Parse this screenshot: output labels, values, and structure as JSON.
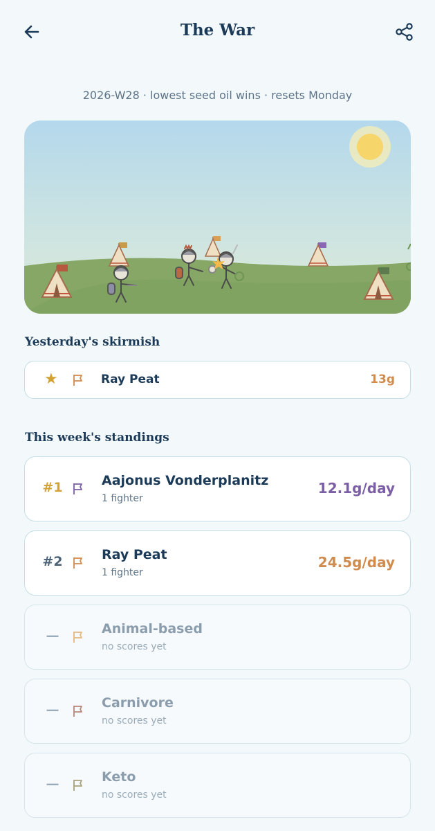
{
  "header": {
    "title": "The War",
    "back_icon": "back-arrow-icon",
    "share_icon": "share-icon"
  },
  "subtitle": "2026-W28 · lowest seed oil wins · resets Monday",
  "scene": {
    "sun_icon": "sun-icon",
    "colors": {
      "sky_top": "#b4d8ec",
      "sky_bottom": "#dfecd9",
      "grass": "#86a766",
      "grass_dark": "#6e9553"
    }
  },
  "yesterday": {
    "heading": "Yesterday's skirmish",
    "winner_icon": "star-icon",
    "name": "Ray Peat",
    "value": "13g",
    "flag_color": "#d08b4e"
  },
  "standings": {
    "heading": "This week's standings",
    "items": [
      {
        "rank": "#1",
        "name": "Aajonus Vonderplanitz",
        "sub": "1 fighter",
        "value": "12.1g/day",
        "rank_color": "#d3a235",
        "flag_color": "#7b5ea3",
        "value_color": "#7b5ea3",
        "empty": false
      },
      {
        "rank": "#2",
        "name": "Ray Peat",
        "sub": "1 fighter",
        "value": "24.5g/day",
        "rank_color": "#4d6478",
        "flag_color": "#d08b4e",
        "value_color": "#d08b4e",
        "empty": false
      },
      {
        "rank": "—",
        "name": "Animal-based",
        "sub": "no scores yet",
        "value": "",
        "flag_color": "#e5b87c",
        "empty": true
      },
      {
        "rank": "—",
        "name": "Carnivore",
        "sub": "no scores yet",
        "value": "",
        "flag_color": "#b6877a",
        "empty": true
      },
      {
        "rank": "—",
        "name": "Keto",
        "sub": "no scores yet",
        "value": "",
        "flag_color": "#a7a27c",
        "empty": true
      }
    ]
  }
}
